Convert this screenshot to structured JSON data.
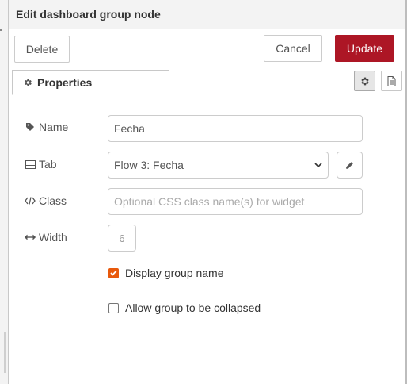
{
  "header": {
    "title": "Edit dashboard group node"
  },
  "toolbar": {
    "delete_label": "Delete",
    "cancel_label": "Cancel",
    "update_label": "Update"
  },
  "tabs": {
    "properties_label": "Properties"
  },
  "form": {
    "name": {
      "label": "Name",
      "value": "Fecha"
    },
    "tab": {
      "label": "Tab",
      "selected": "Flow 3: Fecha"
    },
    "class": {
      "label": "Class",
      "placeholder": "Optional CSS class name(s) for widget",
      "value": ""
    },
    "width": {
      "label": "Width",
      "value": "6"
    },
    "display_group_name": {
      "label": "Display group name",
      "checked": true
    },
    "allow_collapse": {
      "label": "Allow group to be collapsed",
      "checked": false
    }
  },
  "colors": {
    "primary": "#ad1625",
    "checkbox_accent": "#e8590c"
  },
  "icons": {
    "properties": "gear-icon",
    "name": "tag-icon",
    "tab": "table-icon",
    "class": "code-icon",
    "width": "arrows-h-icon",
    "edit": "pencil-icon",
    "info": "file-text-icon"
  }
}
